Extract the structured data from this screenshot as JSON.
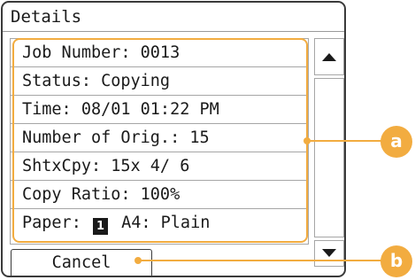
{
  "screen": {
    "title": "Details"
  },
  "details": {
    "rows": [
      {
        "text": "Job Number: 0013"
      },
      {
        "text": "Status: Copying"
      },
      {
        "text": "Time: 08/01 01:22 PM"
      },
      {
        "text": "Number of Orig.:  15"
      },
      {
        "text": "ShtxCpy: 15x 4/ 6"
      },
      {
        "text": "Copy Ratio: 100%"
      },
      {
        "paper_prefix": "Paper:",
        "paper_source": "1",
        "paper_suffix": "A4: Plain"
      }
    ]
  },
  "footer": {
    "cancel_label": "Cancel"
  },
  "callouts": {
    "a": "a",
    "b": "b"
  },
  "colors": {
    "highlight": "#f2ac40",
    "text": "#1a1a1a",
    "border": "#a6a6a6"
  },
  "icons": {
    "scroll_up": "triangle-up",
    "scroll_down": "triangle-down"
  }
}
